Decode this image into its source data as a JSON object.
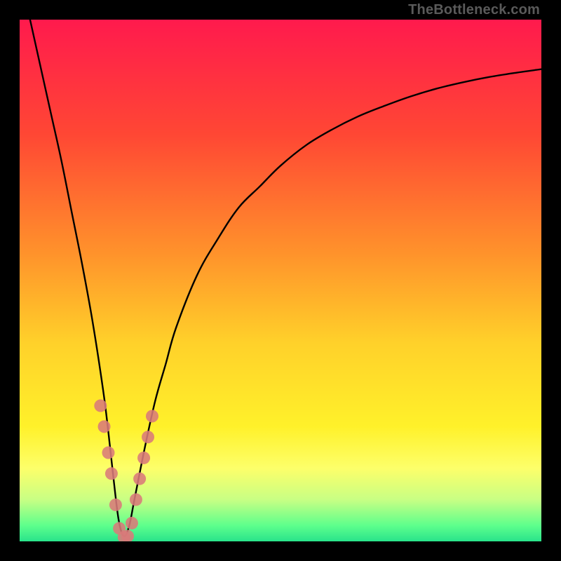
{
  "watermark": "TheBottleneck.com",
  "chart_data": {
    "type": "line",
    "title": "",
    "xlabel": "",
    "ylabel": "",
    "xlim": [
      0,
      100
    ],
    "ylim": [
      0,
      100
    ],
    "grid": false,
    "color_stops": [
      {
        "offset": 0.0,
        "color": "#ff1a4d"
      },
      {
        "offset": 0.22,
        "color": "#ff4734"
      },
      {
        "offset": 0.45,
        "color": "#ff932b"
      },
      {
        "offset": 0.62,
        "color": "#ffd12a"
      },
      {
        "offset": 0.78,
        "color": "#fff12a"
      },
      {
        "offset": 0.86,
        "color": "#fdff6a"
      },
      {
        "offset": 0.92,
        "color": "#c8ff84"
      },
      {
        "offset": 0.97,
        "color": "#5dff8c"
      },
      {
        "offset": 1.0,
        "color": "#29e38b"
      }
    ],
    "series": [
      {
        "name": "bottleneck-curve",
        "x": [
          2,
          4,
          6,
          8,
          10,
          12,
          14,
          16,
          17,
          18,
          19,
          20,
          21,
          22,
          24,
          26,
          28,
          30,
          34,
          38,
          42,
          46,
          50,
          55,
          60,
          65,
          70,
          75,
          80,
          85,
          90,
          95,
          100
        ],
        "y": [
          100,
          91,
          82,
          73,
          63,
          53,
          42,
          29,
          21,
          12,
          4,
          1,
          3,
          8,
          18,
          27,
          34,
          41,
          51,
          58,
          64,
          68,
          72,
          76,
          79,
          81.5,
          83.5,
          85.3,
          86.8,
          88,
          89,
          89.8,
          90.5
        ]
      }
    ],
    "markers": {
      "name": "highlight-dots",
      "color": "#d97a7a",
      "radius": 9,
      "points": [
        {
          "x": 15.5,
          "y": 26
        },
        {
          "x": 16.2,
          "y": 22
        },
        {
          "x": 17.0,
          "y": 17
        },
        {
          "x": 17.6,
          "y": 13
        },
        {
          "x": 18.4,
          "y": 7
        },
        {
          "x": 19.1,
          "y": 2.5
        },
        {
          "x": 20.0,
          "y": 0.8
        },
        {
          "x": 20.7,
          "y": 1.0
        },
        {
          "x": 21.5,
          "y": 3.5
        },
        {
          "x": 22.3,
          "y": 8
        },
        {
          "x": 23.0,
          "y": 12
        },
        {
          "x": 23.8,
          "y": 16
        },
        {
          "x": 24.6,
          "y": 20
        },
        {
          "x": 25.4,
          "y": 24
        }
      ]
    }
  }
}
